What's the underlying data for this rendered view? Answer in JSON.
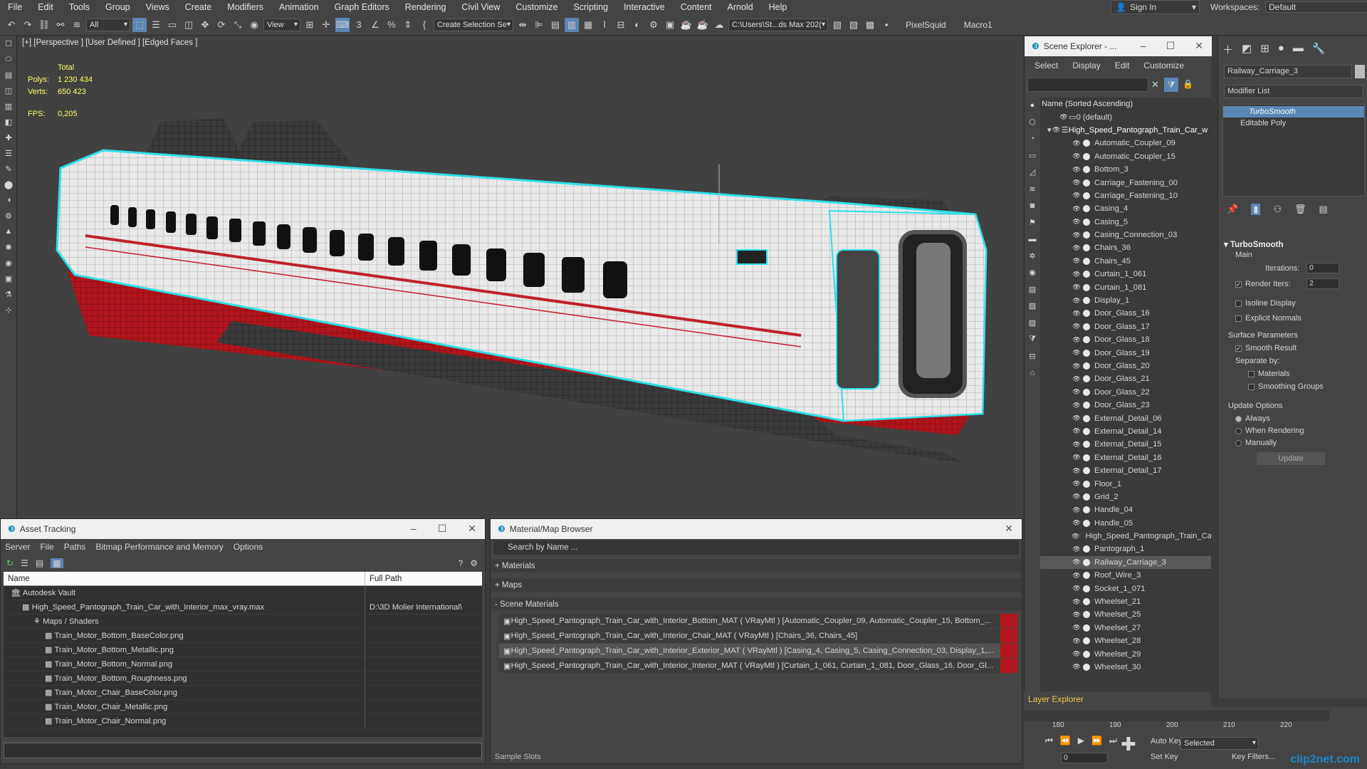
{
  "menu": [
    "File",
    "Edit",
    "Tools",
    "Group",
    "Views",
    "Create",
    "Modifiers",
    "Animation",
    "Graph Editors",
    "Rendering",
    "Civil View",
    "Customize",
    "Scripting",
    "Interactive",
    "Content",
    "Arnold",
    "Help"
  ],
  "signin": "Sign In",
  "workspaces": {
    "label": "Workspaces:",
    "value": "Default"
  },
  "toolbar": {
    "filter": "All",
    "view": "View",
    "selection_set": "Create Selection Se",
    "path": "C:\\Users\\St...ds Max 202(",
    "pixelsquid": "PixelSquid",
    "macro": "Macro1"
  },
  "viewport": {
    "label": "[+] [Perspective ] [User Defined ] [Edged Faces ]",
    "stats": {
      "total": "Total",
      "polys_label": "Polys:",
      "polys": "1 230 434",
      "verts_label": "Verts:",
      "verts": "650 423",
      "fps_label": "FPS:",
      "fps": "0,205"
    }
  },
  "scene_explorer": {
    "title": "Scene Explorer - ...",
    "menu": [
      "Select",
      "Display",
      "Edit",
      "Customize"
    ],
    "col": "Name (Sorted Ascending)",
    "items": [
      "0 (default)",
      "High_Speed_Pantograph_Train_Car_w",
      "Automatic_Coupler_09",
      "Automatic_Coupler_15",
      "Bottom_3",
      "Carriage_Fastening_00",
      "Carriage_Fastening_10",
      "Casing_4",
      "Casing_5",
      "Casing_Connection_03",
      "Chairs_36",
      "Chairs_45",
      "Curtain_1_061",
      "Curtain_1_081",
      "Display_1",
      "Door_Glass_16",
      "Door_Glass_17",
      "Door_Glass_18",
      "Door_Glass_19",
      "Door_Glass_20",
      "Door_Glass_21",
      "Door_Glass_22",
      "Door_Glass_23",
      "External_Detail_06",
      "External_Detail_14",
      "External_Detail_15",
      "External_Detail_16",
      "External_Detail_17",
      "Floor_1",
      "Grid_2",
      "Handle_04",
      "Handle_05",
      "High_Speed_Pantograph_Train_Ca",
      "Pantograph_1",
      "Railway_Carriage_3",
      "Roof_Wire_3",
      "Socket_1_071",
      "Wheelset_21",
      "Wheelset_25",
      "Wheelset_27",
      "Wheelset_28",
      "Wheelset_29",
      "Wheelset_30"
    ],
    "selected": "Railway_Carriage_3",
    "layer_explorer": "Layer Explorer"
  },
  "command_panel": {
    "object_name": "Railway_Carriage_3",
    "modifier_list": "Modifier List",
    "stack": [
      "TurboSmooth",
      "Editable Poly"
    ],
    "rollout": "TurboSmooth",
    "main": "Main",
    "iterations_label": "Iterations:",
    "iterations": "0",
    "render_iters_label": "Render Iters:",
    "render_iters": "2",
    "isoline": "Isoline Display",
    "explicit": "Explicit Normals",
    "surface": "Surface Parameters",
    "smooth": "Smooth Result",
    "separate": "Separate by:",
    "materials": "Materials",
    "smoothing": "Smoothing Groups",
    "update_opts": "Update Options",
    "always": "Always",
    "when_rendering": "When Rendering",
    "manually": "Manually",
    "update": "Update"
  },
  "asset_tracking": {
    "title": "Asset Tracking",
    "menu": [
      "Server",
      "File",
      "Paths",
      "Bitmap Performance and Memory",
      "Options"
    ],
    "cols": [
      "Name",
      "Full Path"
    ],
    "rows": [
      {
        "name": "Autodesk Vault",
        "path": "",
        "lvl": 1
      },
      {
        "name": "High_Speed_Pantograph_Train_Car_with_Interior_max_vray.max",
        "path": "D:\\3D Molier International\\",
        "lvl": 2
      },
      {
        "name": "Maps / Shaders",
        "path": "",
        "lvl": 3
      },
      {
        "name": "Train_Motor_Bottom_BaseColor.png",
        "path": "",
        "lvl": 4
      },
      {
        "name": "Train_Motor_Bottom_Metallic.png",
        "path": "",
        "lvl": 4
      },
      {
        "name": "Train_Motor_Bottom_Normal.png",
        "path": "",
        "lvl": 4
      },
      {
        "name": "Train_Motor_Bottom_Roughness.png",
        "path": "",
        "lvl": 4
      },
      {
        "name": "Train_Motor_Chair_BaseColor.png",
        "path": "",
        "lvl": 4
      },
      {
        "name": "Train_Motor_Chair_Metallic.png",
        "path": "",
        "lvl": 4
      },
      {
        "name": "Train_Motor_Chair_Normal.png",
        "path": "",
        "lvl": 4
      }
    ]
  },
  "material_browser": {
    "title": "Material/Map Browser",
    "search": "Search by Name ...",
    "sections": [
      "+ Materials",
      "+ Maps",
      "- Scene Materials"
    ],
    "materials": [
      "High_Speed_Pantograph_Train_Car_with_Interior_Bottom_MAT ( VRayMtl ) [Automatic_Coupler_09, Automatic_Coupler_15, Bottom_...",
      "High_Speed_Pantograph_Train_Car_with_Interior_Chair_MAT ( VRayMtl ) [Chairs_36, Chairs_45]",
      "High_Speed_Pantograph_Train_Car_with_Interior_Exterior_MAT ( VRayMtl ) [Casing_4, Casing_5, Casing_Connection_03, Display_1,...",
      "High_Speed_Pantograph_Train_Car_with_Interior_Interior_MAT ( VRayMtl ) [Curtain_1_061, Curtain_1_081, Door_Glass_16, Door_Gl..."
    ],
    "bottom_label": "Sample Slots"
  },
  "timeline": {
    "ticks": [
      "180",
      "190",
      "200",
      "210",
      "220"
    ],
    "autokey": "Auto Key",
    "setkey": "Set Key",
    "selected": "Selected",
    "frame": "0",
    "keyfilters": "Key Filters..."
  },
  "watermark": "clip2net.com"
}
